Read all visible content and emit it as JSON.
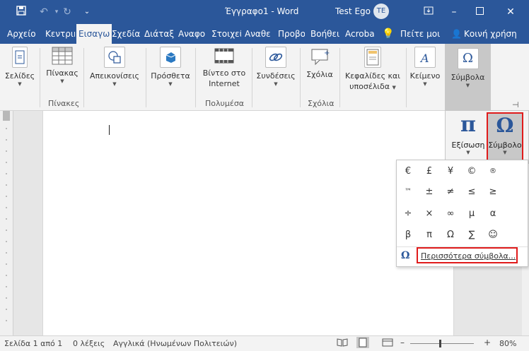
{
  "titlebar": {
    "doc_title": "Έγγραφο1 - Word",
    "user_name": "Test Ego",
    "avatar_initials": "TE"
  },
  "tabs": [
    "Αρχείο",
    "Κεντρικ",
    "Εισαγω",
    "Σχεδίασ",
    "Διάταξ",
    "Αναφο",
    "Στοιχεί",
    "Αναθε",
    "Προβο",
    "Βοήθει",
    "Acroba",
    "Πείτε μοι",
    "Κοινή χρήση"
  ],
  "active_tab": "Εισαγω",
  "ribbon": {
    "pages": "Σελίδες",
    "table": "Πίνακας",
    "tables_group": "Πίνακες",
    "illustrations": "Απεικονίσεις",
    "addins": "Πρόσθετα",
    "video_line1": "Βίντεο στο",
    "video_line2": "Internet",
    "media_group": "Πολυμέσα",
    "links": "Συνδέσεις",
    "comments": "Σχόλια",
    "comments_group": "Σχόλια",
    "headers_line1": "Κεφαλίδες και",
    "headers_line2": "υποσέλιδα",
    "text": "Κείμενο",
    "symbols": "Σύμβολα"
  },
  "symbol_panel": {
    "equation_label": "Εξίσωση",
    "symbol_label": "Σύμβολο"
  },
  "symbols_grid": [
    "€",
    "£",
    "¥",
    "©",
    "®",
    "™",
    "±",
    "≠",
    "≤",
    "≥",
    "÷",
    "×",
    "∞",
    "µ",
    "α",
    "β",
    "π",
    "Ω",
    "∑",
    "☺"
  ],
  "more_symbols": "Περισσότερα σύμβολα...",
  "icons": {
    "omega": "Ω",
    "pi": "π"
  },
  "status": {
    "page": "Σελίδα 1 από 1",
    "words": "0 λέξεις",
    "language": "Αγγλικά (Ηνωμένων Πολιτειών)",
    "zoom": "80%"
  },
  "colors": {
    "word_blue": "#2b579a",
    "highlight_red": "#e01b1b",
    "selected_gray": "#c8c8c8"
  }
}
